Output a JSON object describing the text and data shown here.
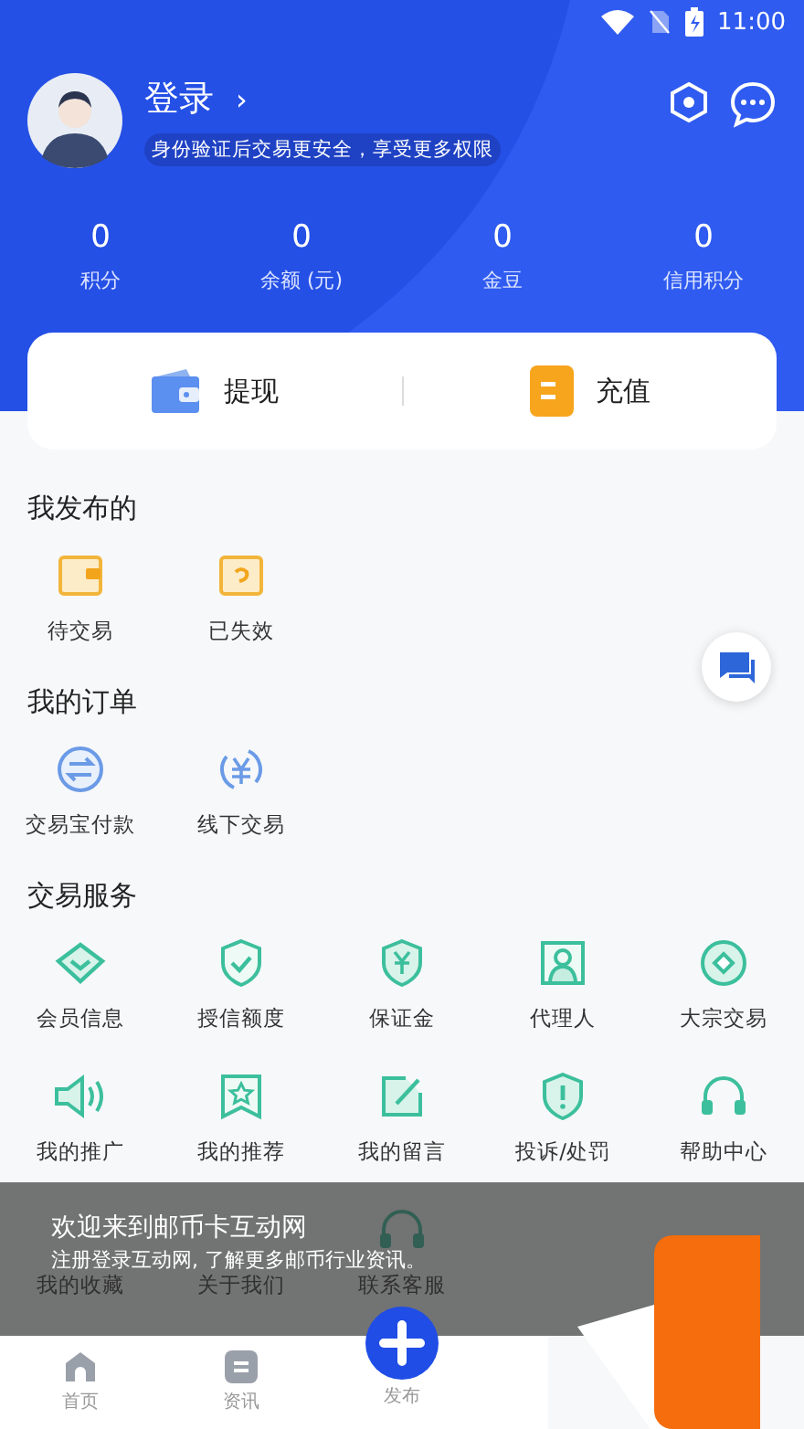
{
  "status_bar": {
    "time": "11:00"
  },
  "profile": {
    "name": "登录",
    "chevron": "›",
    "hint": "身份验证后交易更安全，享受更多权限"
  },
  "stats": [
    {
      "value": "0",
      "label": "积分"
    },
    {
      "value": "0",
      "label": "余额 (元)"
    },
    {
      "value": "0",
      "label": "金豆"
    },
    {
      "value": "0",
      "label": "信用积分"
    }
  ],
  "wallet_actions": [
    {
      "kind": "withdraw",
      "label": "提现"
    },
    {
      "kind": "recharge",
      "label": "充值"
    }
  ],
  "sections": [
    {
      "title": "我发布的",
      "items": [
        {
          "kind": "pending",
          "label": "待交易"
        },
        {
          "kind": "expired",
          "label": "已失效"
        }
      ]
    },
    {
      "title": "我的订单",
      "items": [
        {
          "kind": "escrow",
          "label": "交易宝付款"
        },
        {
          "kind": "offline",
          "label": "线下交易"
        }
      ]
    },
    {
      "title": "交易服务",
      "items": [
        {
          "kind": "diamond",
          "label": "会员信息"
        },
        {
          "kind": "shield-check",
          "label": "授信额度"
        },
        {
          "kind": "shield-yen",
          "label": "保证金"
        },
        {
          "kind": "person",
          "label": "代理人"
        },
        {
          "kind": "circle-diamond",
          "label": "大宗交易"
        },
        {
          "kind": "speaker",
          "label": "我的推广"
        },
        {
          "kind": "star-flag",
          "label": "我的推荐"
        },
        {
          "kind": "edit",
          "label": "我的留言"
        },
        {
          "kind": "shield-alert",
          "label": "投诉/处罚"
        },
        {
          "kind": "headset",
          "label": "帮助中心"
        },
        {
          "kind": "hidden",
          "label": "我的收藏"
        },
        {
          "kind": "hidden",
          "label": "关于我们"
        },
        {
          "kind": "headset",
          "label": "联系客服"
        }
      ]
    }
  ],
  "toast": {
    "title": "欢迎来到邮币卡互动网",
    "message": "注册登录互动网, 了解更多邮币行业资讯。"
  },
  "bottom_nav": [
    {
      "kind": "home",
      "label": "首页"
    },
    {
      "kind": "news",
      "label": "资讯"
    },
    {
      "kind": "publish",
      "label": "发布"
    }
  ]
}
